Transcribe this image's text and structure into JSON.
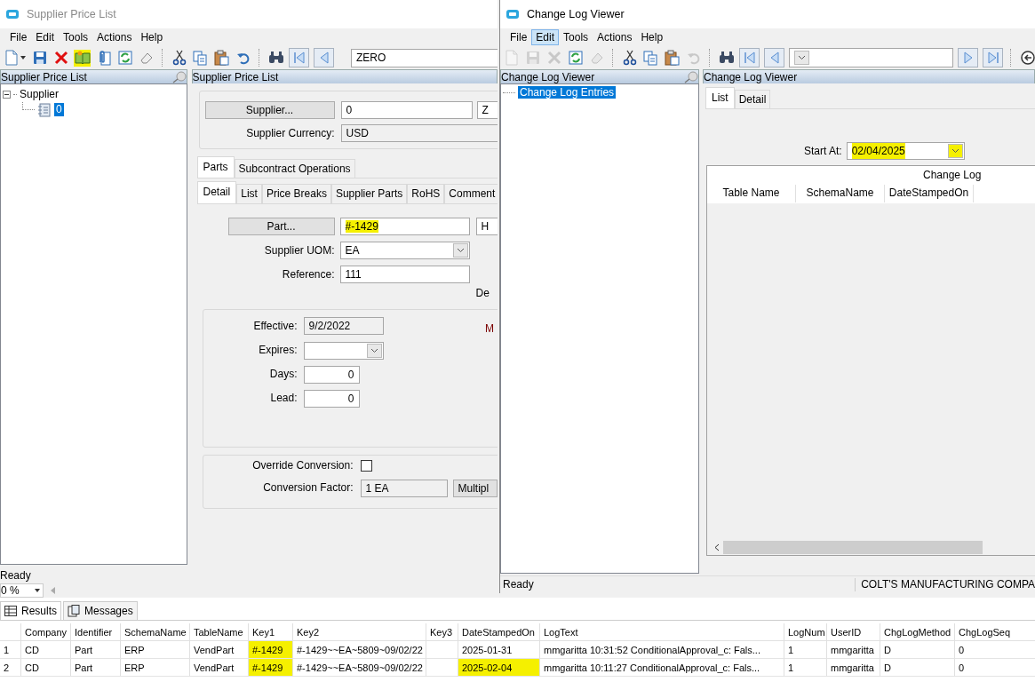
{
  "left_window": {
    "title": "Supplier Price List",
    "menu": [
      {
        "label": "File",
        "selected": false
      },
      {
        "label": "Edit",
        "selected": false
      },
      {
        "label": "Tools",
        "selected": false
      },
      {
        "label": "Actions",
        "selected": false
      },
      {
        "label": "Help",
        "selected": false
      }
    ],
    "toolbar": [
      {
        "kind": "new",
        "highlighted": false
      },
      {
        "kind": "dropdown",
        "highlighted": false
      },
      {
        "kind": "save",
        "highlighted": false
      },
      {
        "kind": "delete",
        "highlighted": false
      },
      {
        "kind": "book",
        "highlighted": true
      },
      {
        "kind": "attach",
        "highlighted": false
      },
      {
        "kind": "refresh",
        "highlighted": false
      },
      {
        "kind": "eraser",
        "highlighted": false
      },
      {
        "kind": "separator",
        "highlighted": false
      },
      {
        "kind": "cut",
        "highlighted": false
      },
      {
        "kind": "copy",
        "highlighted": false
      },
      {
        "kind": "paste",
        "highlighted": false
      },
      {
        "kind": "undo",
        "highlighted": false
      },
      {
        "kind": "separator",
        "highlighted": false
      },
      {
        "kind": "find",
        "highlighted": false
      },
      {
        "kind": "first",
        "highlighted": false
      },
      {
        "kind": "prev",
        "highlighted": false
      },
      {
        "kind": "field",
        "highlighted": false,
        "value": "ZERO"
      }
    ],
    "tree_panel": {
      "title": "Supplier Price List",
      "tree": [
        {
          "label": "Supplier",
          "expanded": true,
          "selected": false,
          "children": [
            {
              "label": "0",
              "selected": true
            }
          ]
        }
      ]
    },
    "detail_panel": {
      "title": "Supplier Price List",
      "supplier_button": "Supplier...",
      "supplier_id": "0",
      "supplier_name": "Z",
      "currency_label": "Supplier Currency:",
      "currency": "USD",
      "tabs": [
        {
          "label": "Parts",
          "selected": true
        },
        {
          "label": "Subcontract Operations",
          "selected": false
        }
      ],
      "subtabs": [
        {
          "label": "Detail",
          "selected": true
        },
        {
          "label": "List",
          "selected": false
        },
        {
          "label": "Price Breaks",
          "selected": false
        },
        {
          "label": "Supplier Parts",
          "selected": false
        },
        {
          "label": "RoHS",
          "selected": false
        },
        {
          "label": "Comment",
          "selected": false
        }
      ],
      "part_button": "Part...",
      "part": {
        "value": "#-1429",
        "highlighted": true
      },
      "part_description": "H",
      "uom_label": "Supplier UOM:",
      "uom": "EA",
      "reference_label": "Reference:",
      "reference": "111",
      "description_label": "De",
      "effective_label": "Effective:",
      "effective": "9/2/2022",
      "side_label": "M",
      "expires_label": "Expires:",
      "days_label": "Days:",
      "days": "0",
      "lead_label": "Lead:",
      "lead": "0",
      "override_label": "Override Conversion:",
      "override_checked": false,
      "factor_label": "Conversion Factor:",
      "factor": "1 EA",
      "factor_button": "Multipl"
    },
    "status": "Ready"
  },
  "right_window": {
    "title": "Change Log Viewer",
    "menu": [
      {
        "label": "File",
        "selected": false
      },
      {
        "label": "Edit",
        "selected": true
      },
      {
        "label": "Tools",
        "selected": false
      },
      {
        "label": "Actions",
        "selected": false
      },
      {
        "label": "Help",
        "selected": false
      }
    ],
    "toolbar": [
      {
        "kind": "new",
        "disabled": true
      },
      {
        "kind": "save",
        "disabled": true
      },
      {
        "kind": "delete",
        "disabled": true
      },
      {
        "kind": "refresh",
        "disabled": false
      },
      {
        "kind": "eraser",
        "disabled": true
      },
      {
        "kind": "separator",
        "disabled": false
      },
      {
        "kind": "cut",
        "disabled": false
      },
      {
        "kind": "copy",
        "disabled": false
      },
      {
        "kind": "paste",
        "disabled": false
      },
      {
        "kind": "undo",
        "disabled": true
      },
      {
        "kind": "separator",
        "disabled": false
      },
      {
        "kind": "find",
        "disabled": false
      },
      {
        "kind": "first",
        "disabled": false
      },
      {
        "kind": "prev",
        "disabled": false
      },
      {
        "kind": "combo",
        "disabled": false
      },
      {
        "kind": "next",
        "disabled": false
      },
      {
        "kind": "last",
        "disabled": false
      },
      {
        "kind": "separator",
        "disabled": false
      },
      {
        "kind": "back",
        "disabled": false
      }
    ],
    "tree_panel": {
      "title": "Change Log Viewer",
      "items": [
        {
          "label": "Change Log Entries",
          "selected": true
        }
      ]
    },
    "main_panel": {
      "title": "Change Log Viewer",
      "tabs": [
        {
          "label": "List",
          "selected": true
        },
        {
          "label": "Detail",
          "selected": false
        }
      ],
      "start_label": "Start At:",
      "start_value": {
        "value": "02/04/2025",
        "highlighted": true
      },
      "grid_caption": "Change Log",
      "columns": [
        "Table Name",
        "SchemaName",
        "DateStampedOn"
      ]
    },
    "status": [
      "Ready",
      "COLT'S MANUFACTURING COMPA"
    ]
  },
  "zoom_combo": "0 %",
  "results": {
    "tabs": [
      {
        "label": "Results",
        "kind": "grid",
        "selected": true
      },
      {
        "label": "Messages",
        "kind": "messages",
        "selected": false
      }
    ],
    "columns": [
      "Company",
      "Identifier",
      "SchemaName",
      "TableName",
      "Key1",
      "Key2",
      "Key3",
      "DateStampedOn",
      "LogText",
      "LogNum",
      "UserID",
      "ChgLogMethod",
      "ChgLogSeq"
    ],
    "rows": [
      {
        "number": "1",
        "cells": [
          {
            "text": "CD",
            "highlighted": false
          },
          {
            "text": "Part",
            "highlighted": false
          },
          {
            "text": "ERP",
            "highlighted": false
          },
          {
            "text": "VendPart",
            "highlighted": false
          },
          {
            "text": "#-1429",
            "highlighted": true
          },
          {
            "text": "#-1429~~EA~5809~09/02/22",
            "highlighted": false
          },
          null,
          {
            "text": "2025-01-31",
            "highlighted": false
          },
          {
            "text": "mmgaritta 10:31:52 ConditionalApproval_c: Fals...",
            "highlighted": false
          },
          {
            "text": "1",
            "highlighted": false
          },
          {
            "text": "mmgaritta",
            "highlighted": false
          },
          {
            "text": "D",
            "highlighted": false
          },
          {
            "text": "0",
            "highlighted": false
          }
        ]
      },
      {
        "number": "2",
        "cells": [
          {
            "text": "CD",
            "highlighted": false
          },
          {
            "text": "Part",
            "highlighted": false
          },
          {
            "text": "ERP",
            "highlighted": false
          },
          {
            "text": "VendPart",
            "highlighted": false
          },
          {
            "text": "#-1429",
            "highlighted": true
          },
          {
            "text": "#-1429~~EA~5809~09/02/22",
            "highlighted": false
          },
          null,
          {
            "text": "2025-02-04",
            "highlighted": true
          },
          {
            "text": "mmgaritta 10:11:27 ConditionalApproval_c: Fals...",
            "highlighted": false
          },
          {
            "text": "1",
            "highlighted": false
          },
          {
            "text": "mmgaritta",
            "highlighted": false
          },
          {
            "text": "D",
            "highlighted": false
          },
          {
            "text": "0",
            "highlighted": false
          }
        ]
      }
    ]
  }
}
